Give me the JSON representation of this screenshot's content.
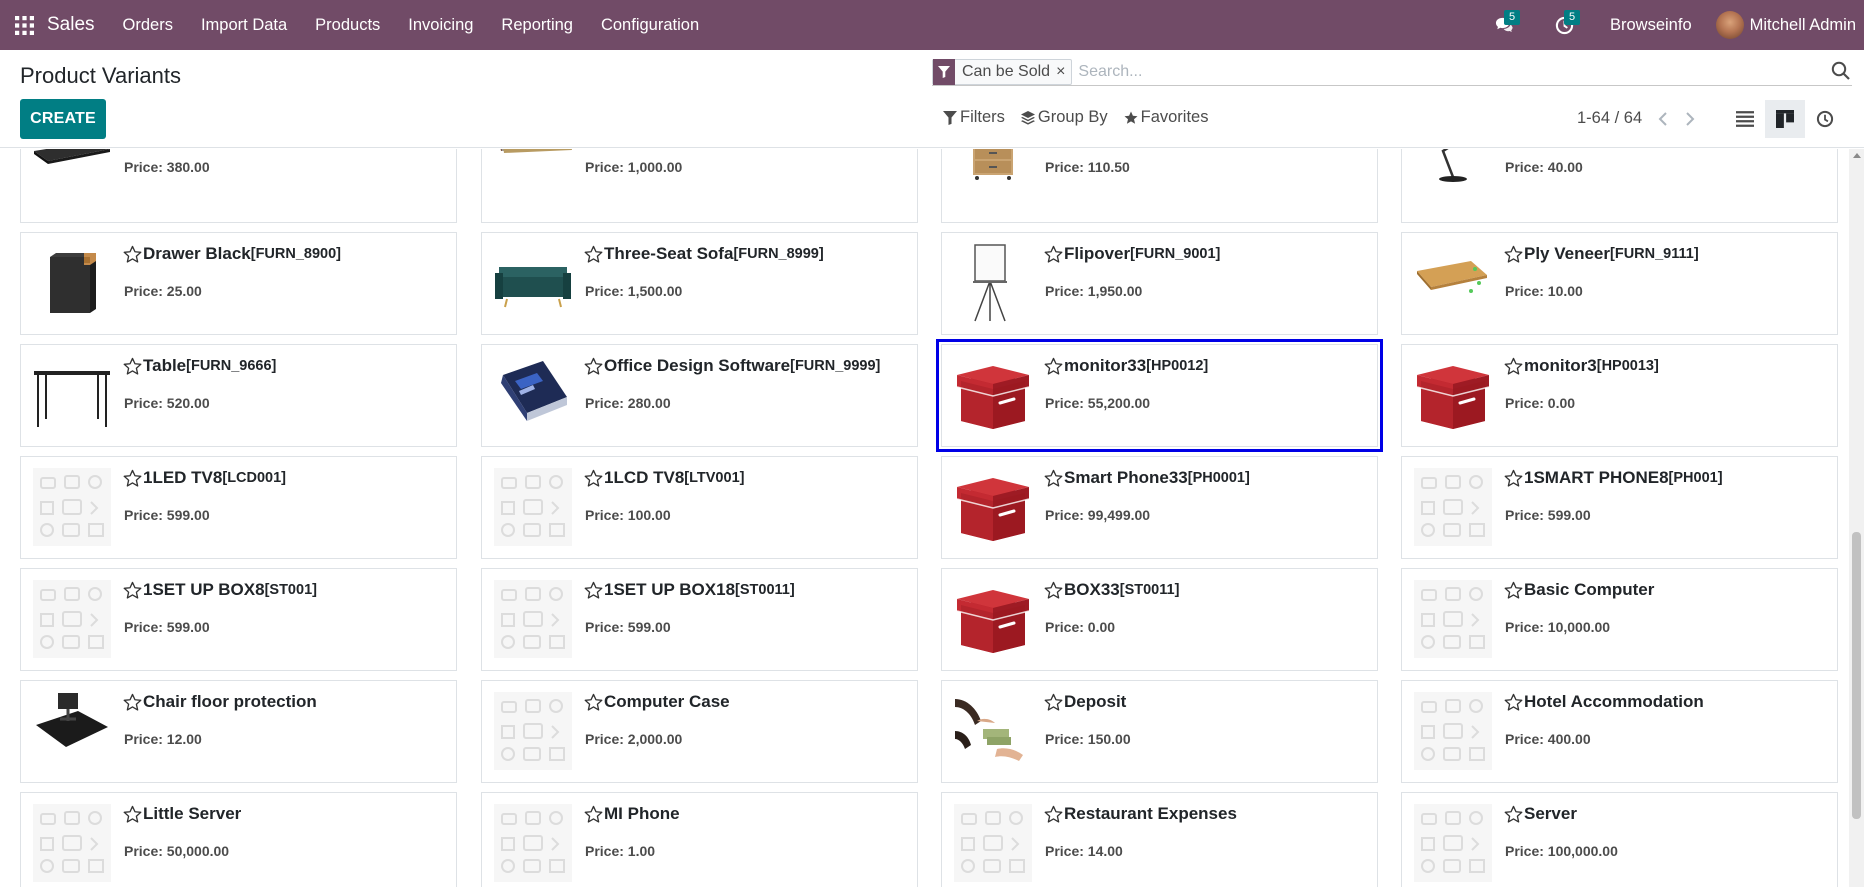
{
  "navbar": {
    "app_name": "Sales",
    "menu": [
      "Orders",
      "Import Data",
      "Products",
      "Invoicing",
      "Reporting",
      "Configuration"
    ],
    "messages_count": "5",
    "activities_count": "5",
    "company": "Browseinfo",
    "user": "Mitchell Admin"
  },
  "control_panel": {
    "title": "Product Variants",
    "create_label": "CREATE",
    "facet_label": "Can be Sold",
    "facet_close": "×",
    "search_placeholder": "Search...",
    "filters_label": "Filters",
    "groupby_label": "Group By",
    "favorites_label": "Favorites",
    "pager": "1-64 / 64"
  },
  "cards": [
    {
      "name": "",
      "code": "",
      "price": "Price: 380.00",
      "img": "tabletop"
    },
    {
      "name": "",
      "code": "",
      "price": "Price: 1,000.00",
      "img": "swatches"
    },
    {
      "name": "",
      "code": "",
      "price": "Price: 110.50",
      "img": "cabinet"
    },
    {
      "name": "",
      "code": "",
      "price": "Price: 40.00",
      "img": "lamp"
    },
    {
      "name": "Drawer Black",
      "code": "[FURN_8900]",
      "price": "Price: 25.00",
      "img": "drawer"
    },
    {
      "name": "Three-Seat Sofa",
      "code": "[FURN_8999]",
      "price": "Price: 1,500.00",
      "img": "sofa"
    },
    {
      "name": "Flipover",
      "code": "[FURN_9001]",
      "price": "Price: 1,950.00",
      "img": "flipover"
    },
    {
      "name": "Ply Veneer",
      "code": "[FURN_9111]",
      "price": "Price: 10.00",
      "img": "plank"
    },
    {
      "name": "Table",
      "code": "[FURN_9666]",
      "price": "Price: 520.00",
      "img": "table"
    },
    {
      "name": "Office Design Software",
      "code": "[FURN_9999]",
      "price": "Price: 280.00",
      "img": "softbox"
    },
    {
      "name": "monitor33",
      "code": "[HP0012]",
      "price": "Price: 55,200.00",
      "img": "redbox",
      "selected": true
    },
    {
      "name": "monitor3",
      "code": "[HP0013]",
      "price": "Price: 0.00",
      "img": "redbox"
    },
    {
      "name": "1LED TV8",
      "code": "[LCD001]",
      "price": "Price: 599.00",
      "img": "placeholder"
    },
    {
      "name": "1LCD TV8",
      "code": "[LTV001]",
      "price": "Price: 100.00",
      "img": "placeholder"
    },
    {
      "name": "Smart Phone33",
      "code": "[PH0001]",
      "price": "Price: 99,499.00",
      "img": "redbox"
    },
    {
      "name": "1SMART PHONE8",
      "code": "[PH001]",
      "price": "Price: 599.00",
      "img": "placeholder"
    },
    {
      "name": "1SET UP BOX8",
      "code": "[ST001]",
      "price": "Price: 599.00",
      "img": "placeholder"
    },
    {
      "name": "1SET UP BOX18",
      "code": "[ST0011]",
      "price": "Price: 599.00",
      "img": "placeholder"
    },
    {
      "name": "BOX33",
      "code": "[ST0011]",
      "price": "Price: 0.00",
      "img": "redbox"
    },
    {
      "name": "Basic Computer",
      "code": "",
      "price": "Price: 10,000.00",
      "img": "placeholder"
    },
    {
      "name": "Chair floor protection",
      "code": "",
      "price": "Price: 12.00",
      "img": "mat"
    },
    {
      "name": "Computer Case",
      "code": "",
      "price": "Price: 2,000.00",
      "img": "placeholder"
    },
    {
      "name": "Deposit",
      "code": "",
      "price": "Price: 150.00",
      "img": "money"
    },
    {
      "name": "Hotel Accommodation",
      "code": "",
      "price": "Price: 400.00",
      "img": "placeholder"
    },
    {
      "name": "Little Server",
      "code": "",
      "price": "Price: 50,000.00",
      "img": "placeholder"
    },
    {
      "name": "MI Phone",
      "code": "",
      "price": "Price: 1.00",
      "img": "placeholder"
    },
    {
      "name": "Restaurant Expenses",
      "code": "",
      "price": "Price: 14.00",
      "img": "placeholder"
    },
    {
      "name": "Server",
      "code": "",
      "price": "Price: 100,000.00",
      "img": "placeholder"
    }
  ],
  "colors": {
    "navbar": "#714b67",
    "primary_button": "#017e84",
    "selection_outline": "#0000e6",
    "product_box_red": "#b3202a"
  }
}
